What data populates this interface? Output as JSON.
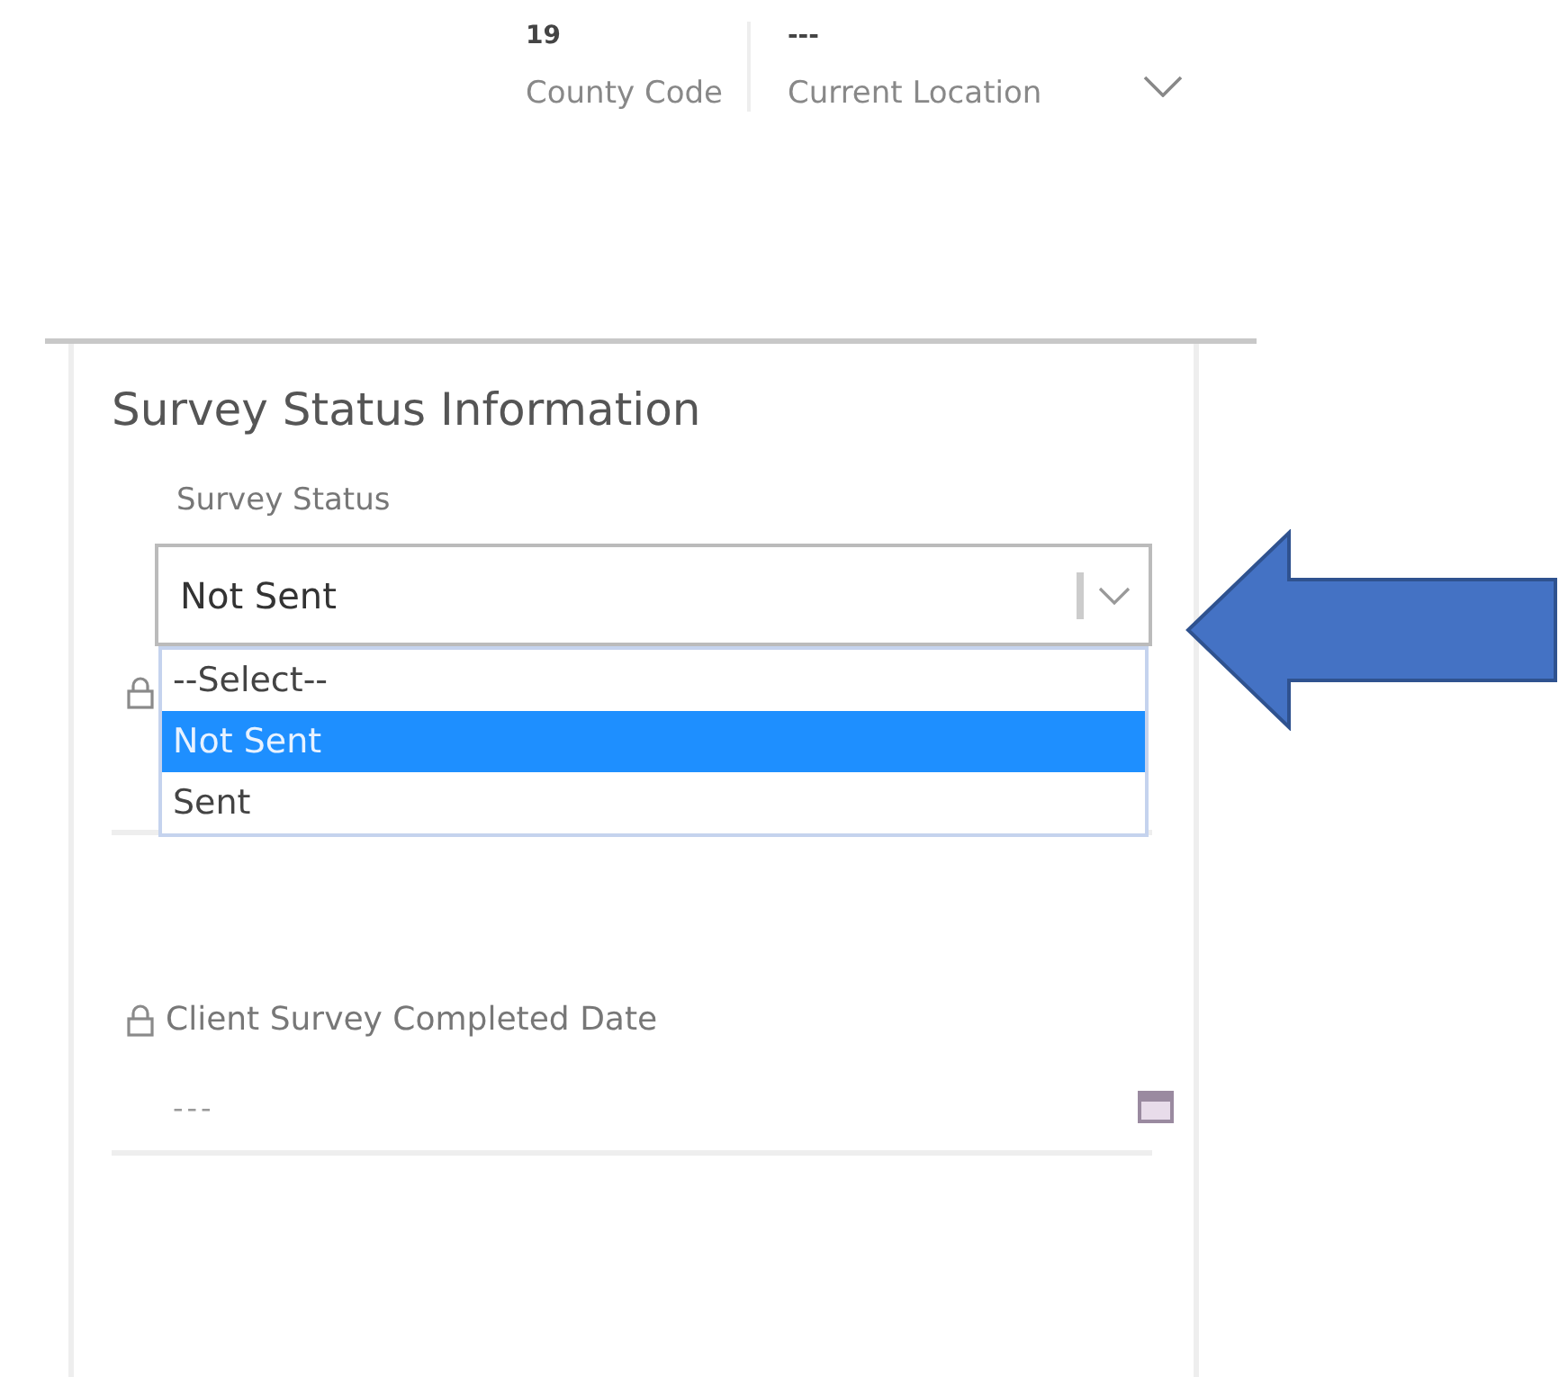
{
  "header_fields": [
    {
      "value": "19",
      "label": "County Code"
    },
    {
      "value": "---",
      "label": "Current Location"
    }
  ],
  "section": {
    "title": "Survey Status Information",
    "survey_status": {
      "label": "Survey Status",
      "value": "Not Sent",
      "expanded": true,
      "options": [
        {
          "label": "--Select--",
          "selected": false
        },
        {
          "label": "Not Sent",
          "selected": true
        },
        {
          "label": "Sent",
          "selected": false
        }
      ]
    },
    "completed_date": {
      "label": "Client Survey Completed Date",
      "value": "---"
    }
  }
}
